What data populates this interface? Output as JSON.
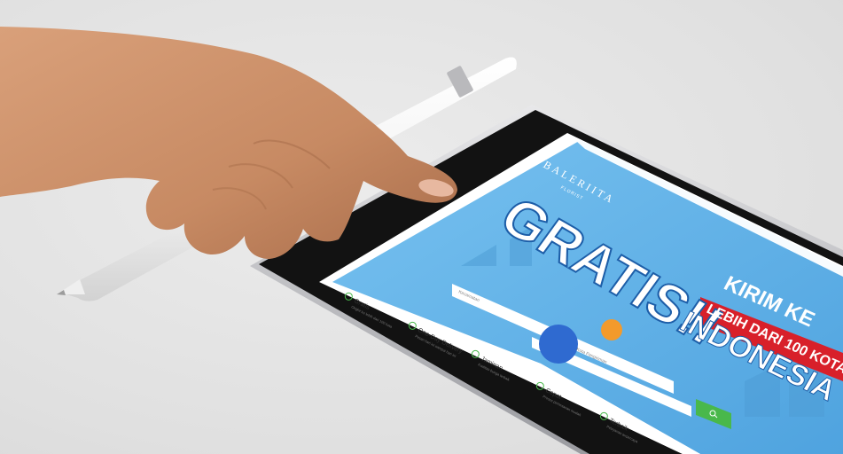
{
  "brand": {
    "name": "BALERIITA",
    "sub": "FLORIST"
  },
  "hero": {
    "headline": "GRATIS!!",
    "line1": "KIRIM KE",
    "line2": "LEBIH DARI 100 KOTA",
    "line3": "INDONESIA"
  },
  "search": {
    "field1_placeholder": "Kecamatan",
    "field2_placeholder": "Kota Pengiriman"
  },
  "features": [
    {
      "title": "Gratis",
      "desc": "Ongkir ke lebih dari 100 kota"
    },
    {
      "title": "One-Day Delivery",
      "desc": "Pesan hari ini sampai hari ini"
    },
    {
      "title": "Jaminan",
      "desc": "Kualitas bunga terbaik"
    },
    {
      "title": "Cepat",
      "desc": "Proses pemesanan mudah"
    },
    {
      "title": "Terbaik",
      "desc": "Pelayanan terpercaya"
    }
  ],
  "colors": {
    "sky": "#66b6ea",
    "banner_red": "#d8202a",
    "search_button": "#49b84b",
    "bezel": "#111111",
    "skin": "#c98c68"
  }
}
